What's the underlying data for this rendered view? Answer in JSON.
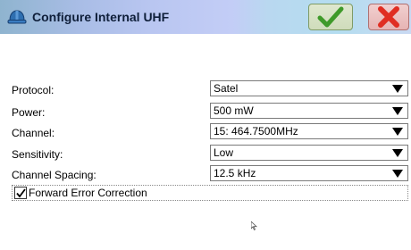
{
  "window": {
    "title": "Configure Internal UHF"
  },
  "actions": {
    "ok_icon": "checkmark-icon",
    "cancel_icon": "x-icon"
  },
  "colors": {
    "ok_green": "#3f9a2a",
    "cancel_red": "#e02d22",
    "title_text": "#0f1f3a"
  },
  "settings": [
    {
      "label": "Protocol:",
      "value": "Satel"
    },
    {
      "label": "Power:",
      "value": "500 mW"
    },
    {
      "label": "Channel:",
      "value": "15: 464.7500MHz"
    },
    {
      "label": "Sensitivity:",
      "value": "Low"
    },
    {
      "label": "Channel Spacing:",
      "value": "12.5 kHz"
    }
  ],
  "fec": {
    "label": "Forward Error Correction",
    "checked": true
  }
}
